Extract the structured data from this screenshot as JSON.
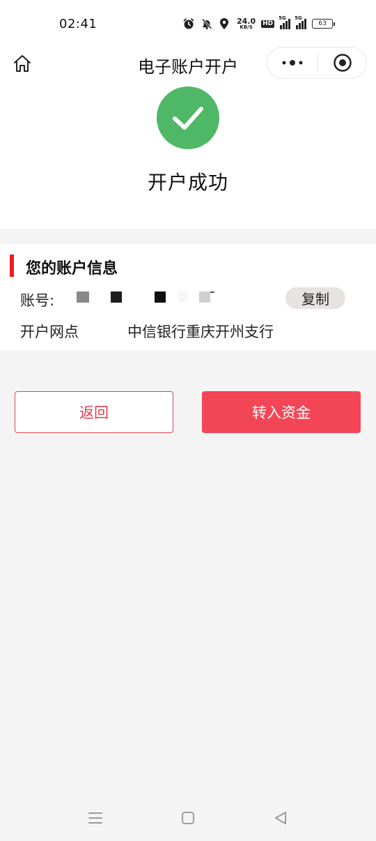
{
  "status_bar": {
    "time": "02:41",
    "net_speed_value": "24.0",
    "net_speed_unit": "KB/S",
    "hd_badge": "HD",
    "signal_1_tag": "5G",
    "signal_2_tag": "5G",
    "battery": "63"
  },
  "header": {
    "title": "电子账户开户"
  },
  "success": {
    "message": "开户成功"
  },
  "account": {
    "title": "您的账户信息",
    "number_label": "账号:",
    "copy_label": "复制",
    "branch_label": "开户网点",
    "branch_value": "中信银行重庆开州支行"
  },
  "actions": {
    "back_label": "返回",
    "transfer_label": "转入资金"
  },
  "colors": {
    "accent_red": "#f24657",
    "success_green": "#4fb866",
    "title_bar_red": "#ee1c25"
  }
}
